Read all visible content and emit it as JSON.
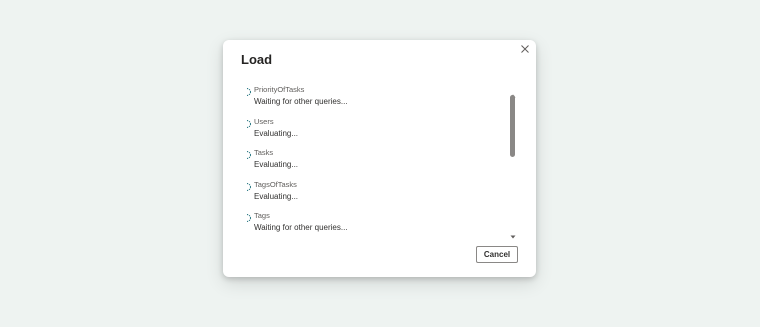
{
  "dialog": {
    "title": "Load",
    "close_icon": "close-icon",
    "cancel_label": "Cancel",
    "queries": [
      {
        "name": "PriorityOfTasks",
        "status": "Waiting for other queries..."
      },
      {
        "name": "Users",
        "status": "Evaluating..."
      },
      {
        "name": "Tasks",
        "status": "Evaluating..."
      },
      {
        "name": "TagsOfTasks",
        "status": "Evaluating..."
      },
      {
        "name": "Tags",
        "status": "Waiting for other queries..."
      }
    ]
  },
  "colors": {
    "background": "#eef3f1",
    "dialog": "#ffffff",
    "spinner": "#1a6e7a",
    "scroll_thumb": "#8a8886"
  }
}
